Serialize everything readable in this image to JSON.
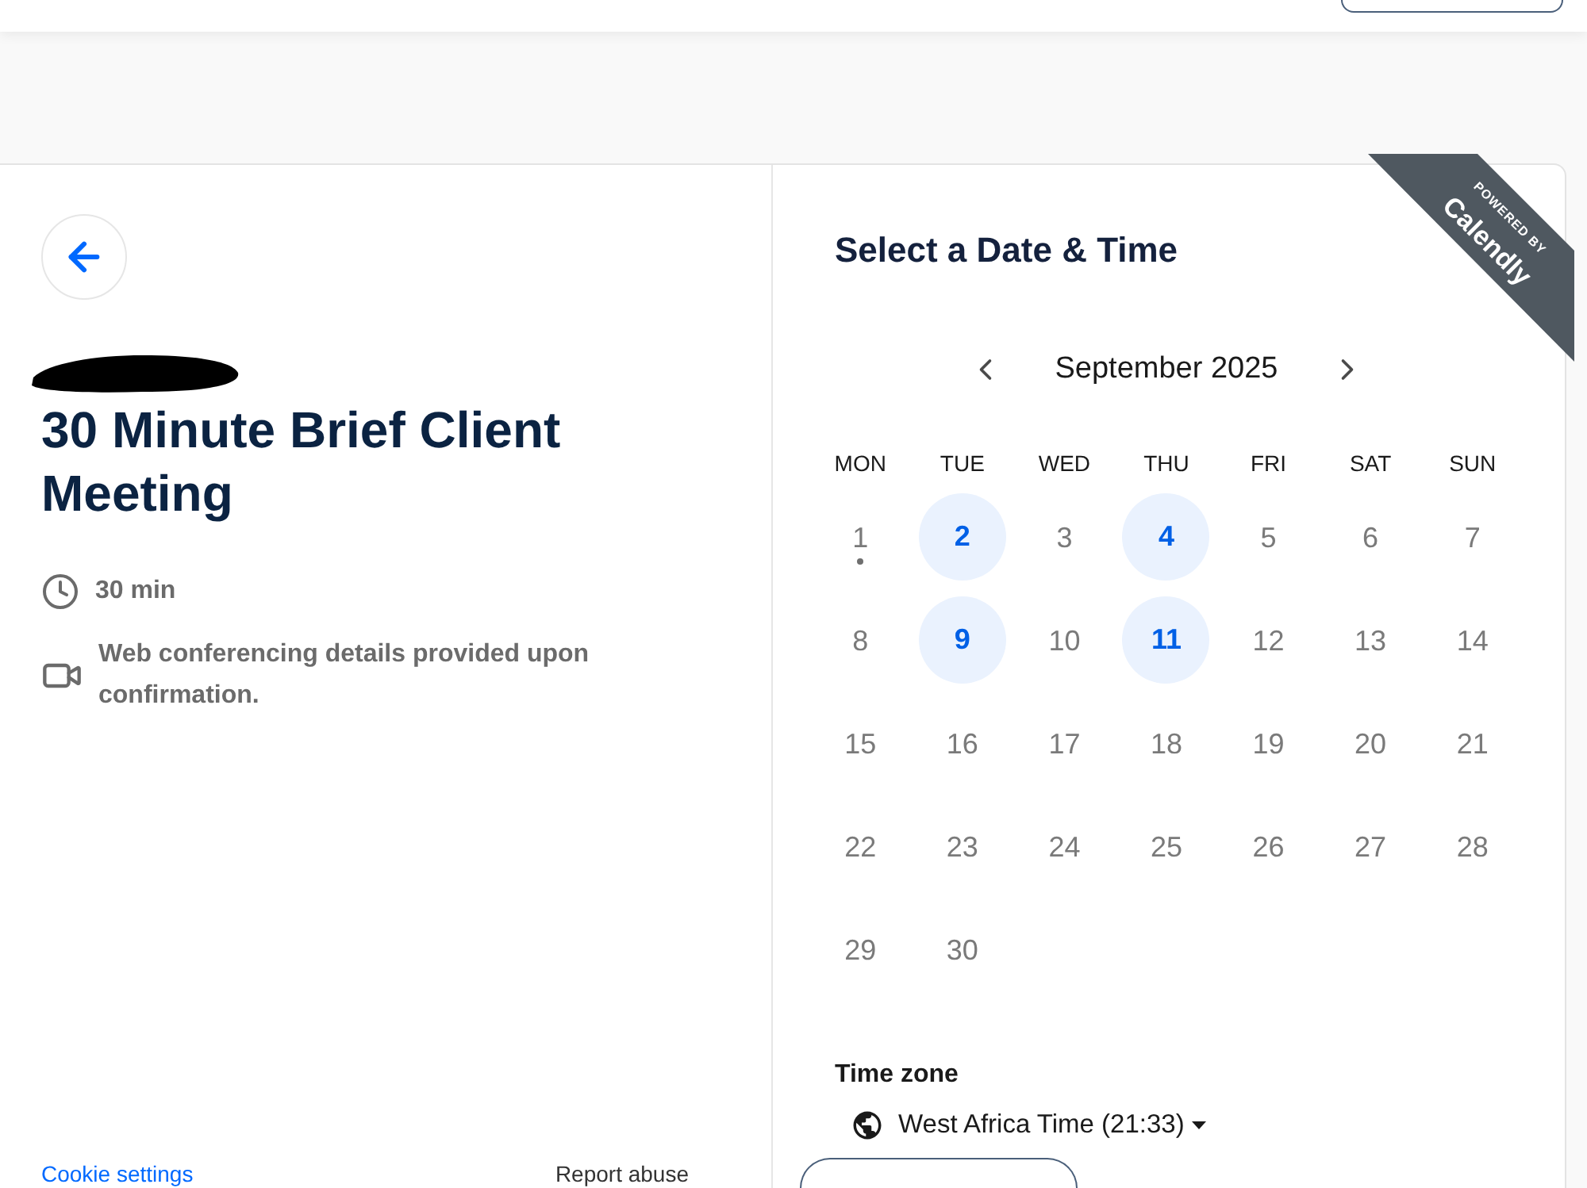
{
  "event": {
    "title": "30 Minute Brief Client Meeting",
    "details": [
      {
        "kind": "duration",
        "text": "30 min"
      },
      {
        "kind": "conferencing",
        "text": "Web conferencing details provided upon confirmation."
      }
    ]
  },
  "footer_links": [
    {
      "kind": "link",
      "label": "Cookie settings"
    },
    {
      "kind": "plain",
      "label": "Report abuse"
    }
  ],
  "ribbon": {
    "caption": "POWERED BY",
    "brand": "Calendly"
  },
  "calendar": {
    "title": "Select a Date & Time",
    "month": "September 2025",
    "weekdays": [
      "MON",
      "TUE",
      "WED",
      "THU",
      "FRI",
      "SAT",
      "SUN"
    ],
    "days": [
      {
        "label": "1",
        "available": false,
        "today": true
      },
      {
        "label": "2",
        "available": true,
        "today": false
      },
      {
        "label": "3",
        "available": false,
        "today": false
      },
      {
        "label": "4",
        "available": true,
        "today": false
      },
      {
        "label": "5",
        "available": false,
        "today": false
      },
      {
        "label": "6",
        "available": false,
        "today": false
      },
      {
        "label": "7",
        "available": false,
        "today": false
      },
      {
        "label": "8",
        "available": false,
        "today": false
      },
      {
        "label": "9",
        "available": true,
        "today": false
      },
      {
        "label": "10",
        "available": false,
        "today": false
      },
      {
        "label": "11",
        "available": true,
        "today": false
      },
      {
        "label": "12",
        "available": false,
        "today": false
      },
      {
        "label": "13",
        "available": false,
        "today": false
      },
      {
        "label": "14",
        "available": false,
        "today": false
      },
      {
        "label": "15",
        "available": false,
        "today": false
      },
      {
        "label": "16",
        "available": false,
        "today": false
      },
      {
        "label": "17",
        "available": false,
        "today": false
      },
      {
        "label": "18",
        "available": false,
        "today": false
      },
      {
        "label": "19",
        "available": false,
        "today": false
      },
      {
        "label": "20",
        "available": false,
        "today": false
      },
      {
        "label": "21",
        "available": false,
        "today": false
      },
      {
        "label": "22",
        "available": false,
        "today": false
      },
      {
        "label": "23",
        "available": false,
        "today": false
      },
      {
        "label": "24",
        "available": false,
        "today": false
      },
      {
        "label": "25",
        "available": false,
        "today": false
      },
      {
        "label": "26",
        "available": false,
        "today": false
      },
      {
        "label": "27",
        "available": false,
        "today": false
      },
      {
        "label": "28",
        "available": false,
        "today": false
      },
      {
        "label": "29",
        "available": false,
        "today": false
      },
      {
        "label": "30",
        "available": false,
        "today": false
      }
    ]
  },
  "time_zone": {
    "label": "Time zone",
    "value": "West Africa Time (21:33)"
  }
}
